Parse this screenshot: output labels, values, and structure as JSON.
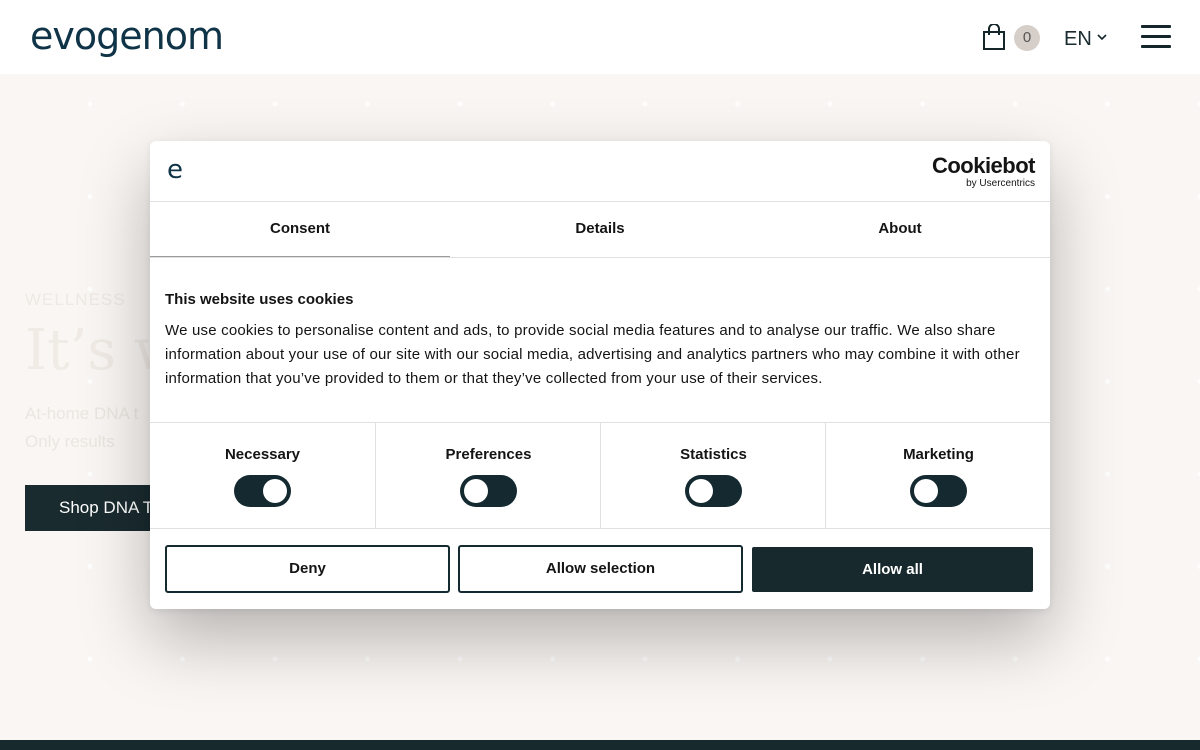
{
  "header": {
    "logo_text": "evogenom",
    "cart_count": "0",
    "language": "EN"
  },
  "hero": {
    "eyebrow": "WELLNESS",
    "title": "It’s w",
    "subtitle_line1": "At-home DNA t",
    "subtitle_line2": "Only results",
    "cta_label": "Shop DNA Te"
  },
  "cookie_dialog": {
    "logo_text": "e",
    "brand_name": "Cookiebot",
    "brand_sub": "by Usercentrics",
    "tabs": [
      {
        "label": "Consent",
        "active": true
      },
      {
        "label": "Details",
        "active": false
      },
      {
        "label": "About",
        "active": false
      }
    ],
    "heading": "This website uses cookies",
    "body": "We use cookies to personalise content and ads, to provide social media features and to analyse our traffic. We also share information about your use of our site with our social media, advertising and analytics partners who may combine it with other information that you’ve provided to them or that they’ve collected from your use of their services.",
    "toggles": [
      {
        "label": "Necessary",
        "checked": true
      },
      {
        "label": "Preferences",
        "checked": false
      },
      {
        "label": "Statistics",
        "checked": false
      },
      {
        "label": "Marketing",
        "checked": false
      }
    ],
    "buttons": {
      "deny": "Deny",
      "allow_selection": "Allow selection",
      "allow_all": "Allow all"
    }
  },
  "colors": {
    "brand_dark": "#17292c",
    "logo_blue": "#0f3347",
    "page_background": "#faf6f3"
  }
}
